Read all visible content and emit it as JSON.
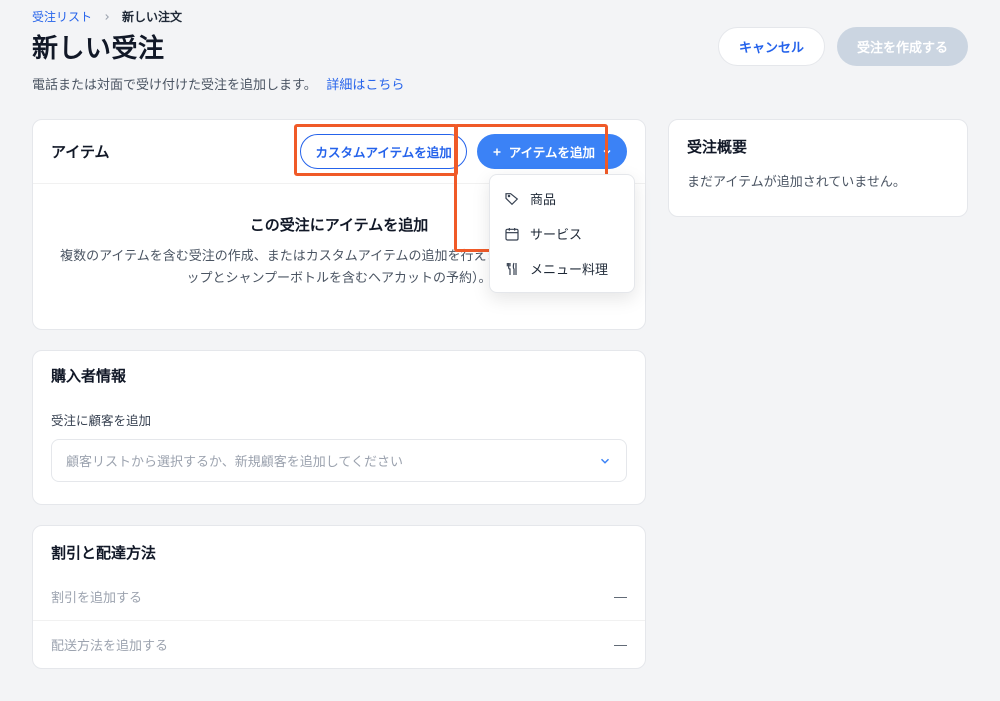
{
  "breadcrumb": {
    "parent": "受注リスト",
    "current": "新しい注文"
  },
  "header": {
    "title": "新しい受注",
    "subtitle": "電話または対面で受け付けた受注を追加します。",
    "learn_more": "詳細はこちら",
    "cancel": "キャンセル",
    "create": "受注を作成する"
  },
  "items_card": {
    "title": "アイテム",
    "add_custom": "カスタムアイテムを追加",
    "add_item": "アイテムを追加",
    "dropdown": {
      "product": "商品",
      "service": "サービス",
      "menu": "メニュー料理"
    },
    "empty_title": "この受注にアイテムを追加",
    "empty_desc": "複数のアイテムを含む受注の作成、またはカスタムアイテムの追加を行えます（例：10ドルのチップとシャンプーボトルを含むヘアカットの予約）。"
  },
  "buyer_card": {
    "title": "購入者情報",
    "field_label": "受注に顧客を追加",
    "placeholder": "顧客リストから選択するか、新規顧客を追加してください"
  },
  "discount_card": {
    "title": "割引と配達方法",
    "add_discount": "割引を追加する",
    "add_shipping": "配送方法を追加する",
    "dash": "—"
  },
  "summary_card": {
    "title": "受注概要",
    "empty": "まだアイテムが追加されていません。"
  }
}
